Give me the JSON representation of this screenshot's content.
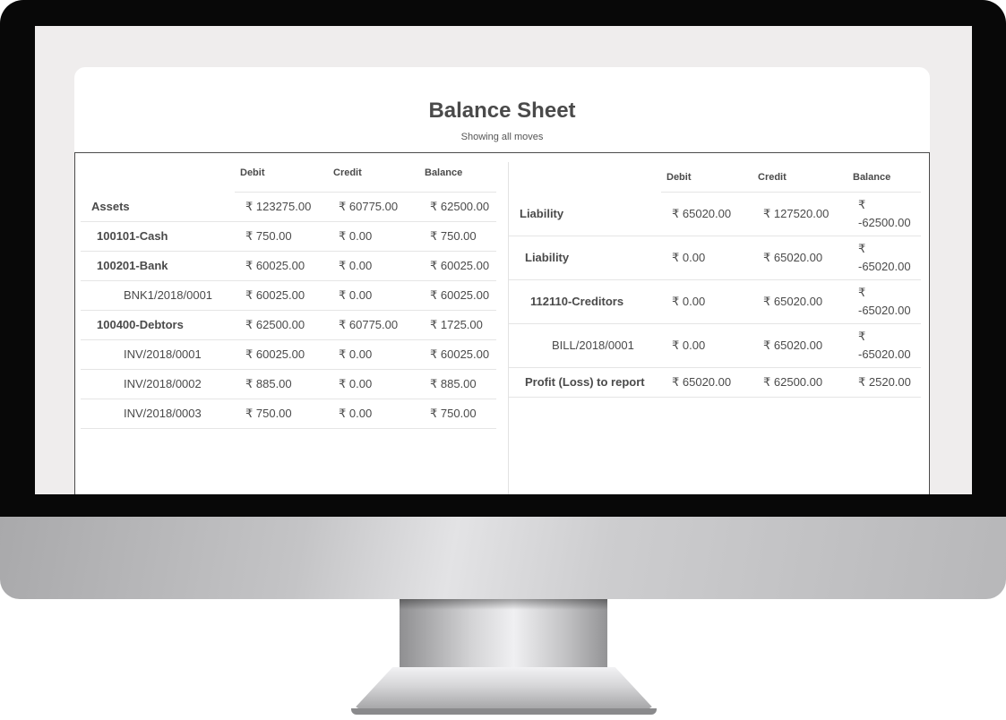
{
  "report": {
    "title": "Balance Sheet",
    "subtitle": "Showing all moves"
  },
  "columns": {
    "debit": "Debit",
    "credit": "Credit",
    "balance": "Balance"
  },
  "assets_rows": [
    {
      "name": "Assets",
      "level": 0,
      "debit": "₹ 123275.00",
      "credit": "₹ 60775.00",
      "balance": "₹ 62500.00"
    },
    {
      "name": "100101-Cash",
      "level": 1,
      "debit": "₹ 750.00",
      "credit": "₹ 0.00",
      "balance": "₹ 750.00"
    },
    {
      "name": "100201-Bank",
      "level": 1,
      "debit": "₹ 60025.00",
      "credit": "₹ 0.00",
      "balance": "₹ 60025.00"
    },
    {
      "name": "BNK1/2018/0001",
      "level": 3,
      "debit": "₹ 60025.00",
      "credit": "₹ 0.00",
      "balance": "₹ 60025.00"
    },
    {
      "name": "100400-Debtors",
      "level": 1,
      "debit": "₹ 62500.00",
      "credit": "₹ 60775.00",
      "balance": "₹ 1725.00"
    },
    {
      "name": "INV/2018/0001",
      "level": 3,
      "debit": "₹ 60025.00",
      "credit": "₹ 0.00",
      "balance": "₹ 60025.00"
    },
    {
      "name": "INV/2018/0002",
      "level": 3,
      "debit": "₹ 885.00",
      "credit": "₹ 0.00",
      "balance": "₹ 885.00"
    },
    {
      "name": "INV/2018/0003",
      "level": 3,
      "debit": "₹ 750.00",
      "credit": "₹ 0.00",
      "balance": "₹ 750.00"
    }
  ],
  "liability_rows": [
    {
      "name": "Liability",
      "level": 0,
      "debit": "₹ 65020.00",
      "credit": "₹ 127520.00",
      "balance": "₹ -62500.00"
    },
    {
      "name": "Liability",
      "level": 1,
      "debit": "₹ 0.00",
      "credit": "₹ 65020.00",
      "balance": "₹ -65020.00"
    },
    {
      "name": "112110-Creditors",
      "level": 2,
      "debit": "₹ 0.00",
      "credit": "₹ 65020.00",
      "balance": "₹ -65020.00"
    },
    {
      "name": "BILL/2018/0001",
      "level": 3,
      "debit": "₹ 0.00",
      "credit": "₹ 65020.00",
      "balance": "₹ -65020.00"
    },
    {
      "name": "Profit (Loss) to report",
      "level": 1,
      "debit": "₹ 65020.00",
      "credit": "₹ 62500.00",
      "balance": "₹ 2520.00"
    }
  ]
}
